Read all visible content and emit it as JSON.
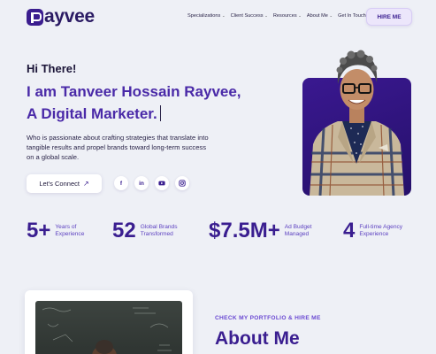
{
  "header": {
    "logo_text": "ayvee",
    "nav": [
      {
        "label": "Specializations",
        "has_dropdown": true
      },
      {
        "label": "Client Success",
        "has_dropdown": true
      },
      {
        "label": "Resources",
        "has_dropdown": true
      },
      {
        "label": "About Me",
        "has_dropdown": true
      },
      {
        "label": "Get In Touch",
        "has_dropdown": true
      }
    ],
    "hire_button": "HIRE ME"
  },
  "hero": {
    "greeting": "Hi There!",
    "headline_line1": "I am Tanveer Hossain Rayvee,",
    "headline_line2": "A Digital Marketer.",
    "intro": "Who is passionate about crafting strategies that translate into tangible results and propel brands toward long-term success on a global scale.",
    "connect_button": "Let's Connect",
    "socials": [
      {
        "name": "facebook",
        "glyph": "f"
      },
      {
        "name": "linkedin",
        "glyph": "in"
      },
      {
        "name": "youtube",
        "glyph": ""
      },
      {
        "name": "instagram",
        "glyph": ""
      }
    ]
  },
  "stats": [
    {
      "value": "5+",
      "label_line1": "Years of",
      "label_line2": "Experience"
    },
    {
      "value": "52",
      "label_line1": "Global Brands",
      "label_line2": "Transformed"
    },
    {
      "value": "$7.5M+",
      "label_line1": "Ad Budget",
      "label_line2": "Managed"
    },
    {
      "value": "4",
      "label_line1": "Full-time Agency",
      "label_line2": "Experience"
    }
  ],
  "about": {
    "kicker": "CHECK MY PORTFOLIO & HIRE ME",
    "title": "About Me"
  },
  "colors": {
    "primary": "#3a1e90",
    "accent": "#4a2aa8",
    "background": "#eef0f6",
    "card": "#2a1270"
  }
}
